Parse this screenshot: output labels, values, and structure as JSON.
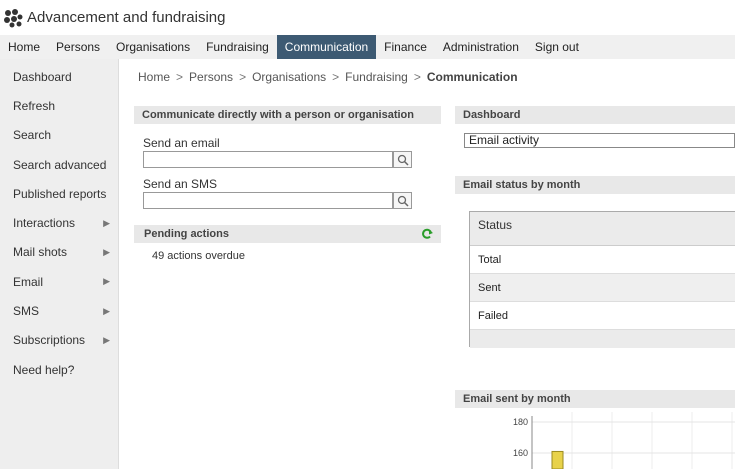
{
  "app": {
    "title": "Advancement and fundraising"
  },
  "nav": {
    "items": [
      "Home",
      "Persons",
      "Organisations",
      "Fundraising",
      "Communication",
      "Finance",
      "Administration",
      "Sign out"
    ],
    "active": "Communication"
  },
  "sidebar": {
    "items": [
      {
        "label": "Dashboard",
        "has_submenu": false
      },
      {
        "label": "Refresh",
        "has_submenu": false
      },
      {
        "label": "Search",
        "has_submenu": false
      },
      {
        "label": "Search advanced",
        "has_submenu": false
      },
      {
        "label": "Published reports",
        "has_submenu": false
      },
      {
        "label": "Interactions",
        "has_submenu": true
      },
      {
        "label": "Mail shots",
        "has_submenu": true
      },
      {
        "label": "Email",
        "has_submenu": true
      },
      {
        "label": "SMS",
        "has_submenu": true
      },
      {
        "label": "Subscriptions",
        "has_submenu": true
      },
      {
        "label": "Need help?",
        "has_submenu": false
      }
    ]
  },
  "breadcrumb": [
    "Home",
    "Persons",
    "Organisations",
    "Fundraising",
    "Communication"
  ],
  "communicate": {
    "title": "Communicate directly with a person or organisation",
    "email_label": "Send an email",
    "sms_label": "Send an SMS",
    "email_value": "",
    "sms_value": ""
  },
  "pending": {
    "title": "Pending actions",
    "text": "49 actions overdue"
  },
  "dashboard": {
    "title": "Dashboard",
    "select_value": "Email activity"
  },
  "email_status": {
    "title": "Email status by month",
    "header": "Status",
    "rows": [
      "Total",
      "Sent",
      "Failed"
    ]
  },
  "email_sent": {
    "title": "Email sent by month"
  },
  "chart_data": {
    "type": "bar",
    "title": "",
    "xlabel": "",
    "ylabel": "",
    "ylim": [
      140,
      180
    ],
    "yticks": [
      180,
      160
    ],
    "categories": [
      ""
    ],
    "values": [
      161
    ]
  },
  "colors": {
    "nav_active": "#3d5a73",
    "bar": "#e8d24a",
    "bar_border": "#9a8a20"
  }
}
